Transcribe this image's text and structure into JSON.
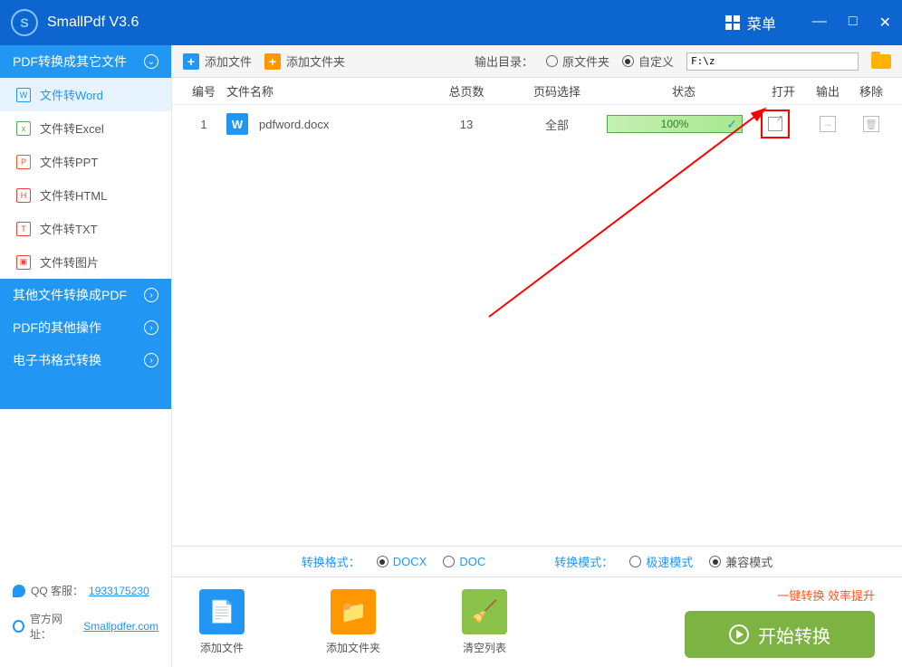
{
  "app": {
    "title": "SmallPdf V3.6",
    "menu_label": "菜单"
  },
  "sidebar": {
    "headers": {
      "main": "PDF转换成其它文件",
      "other_to_pdf": "其他文件转换成PDF",
      "pdf_ops": "PDF的其他操作",
      "ebook": "电子书格式转换"
    },
    "items": [
      "文件转Word",
      "文件转Excel",
      "文件转PPT",
      "文件转HTML",
      "文件转TXT",
      "文件转图片"
    ],
    "item_icons": [
      "W",
      "x",
      "P",
      "H",
      "T",
      "▣"
    ],
    "footer": {
      "qq_label": "QQ 客服：",
      "qq_num": "1933175230",
      "site_label": "官方网址：",
      "site_url": "Smallpdfer.com"
    }
  },
  "toolbar": {
    "add_file": "添加文件",
    "add_folder": "添加文件夹",
    "output_label": "输出目录：",
    "opt_original": "原文件夹",
    "opt_custom": "自定义",
    "path": "F:\\z"
  },
  "table": {
    "cols": {
      "num": "编号",
      "name": "文件名称",
      "pages": "总页数",
      "range": "页码选择",
      "status": "状态",
      "open": "打开",
      "output": "输出",
      "remove": "移除"
    },
    "rows": [
      {
        "num": "1",
        "icon": "W",
        "name": "pdfword.docx",
        "pages": "13",
        "range": "全部",
        "progress": "100%"
      }
    ]
  },
  "format_bar": {
    "format_label": "转换格式：",
    "docx": "DOCX",
    "doc": "DOC",
    "mode_label": "转换模式：",
    "fast": "极速模式",
    "compat": "兼容模式"
  },
  "bottom": {
    "add_file": "添加文件",
    "add_folder": "添加文件夹",
    "clear": "清空列表",
    "tagline": "一键转换  效率提升",
    "start": "开始转换"
  }
}
